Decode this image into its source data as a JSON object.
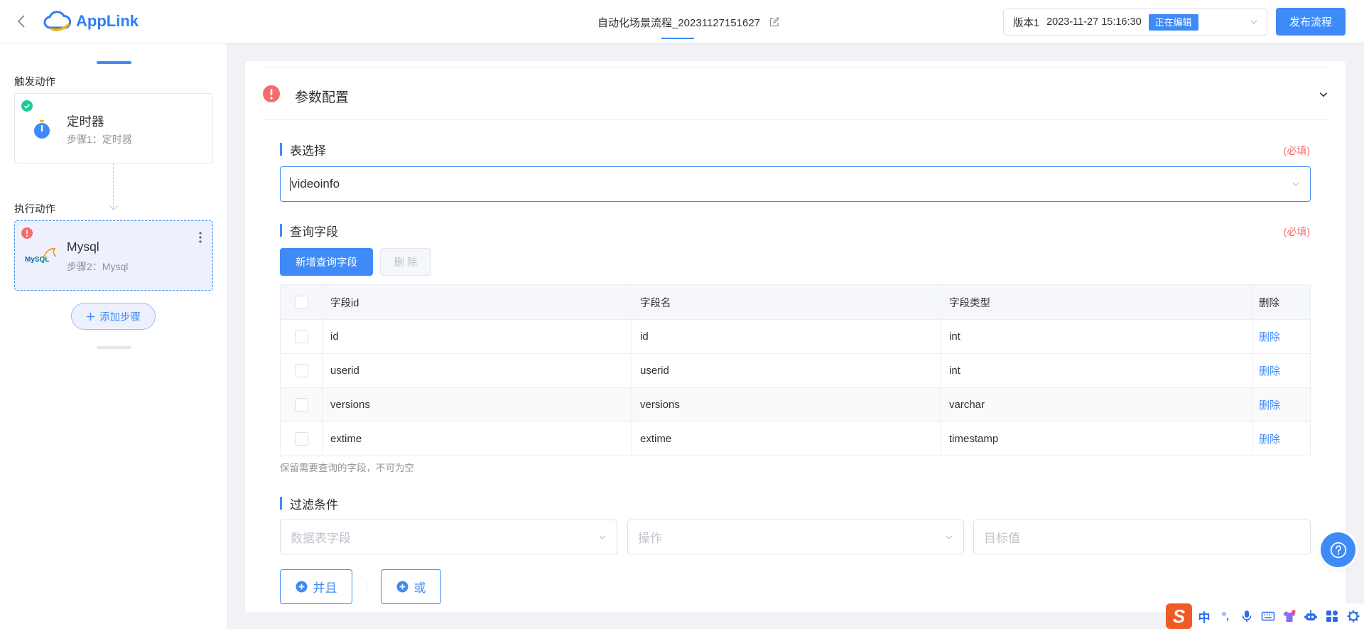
{
  "colors": {
    "primary": "#3e8bf8",
    "danger": "#f56c6c",
    "success": "#20c997",
    "page_bg": "#f0f2f5",
    "selected_bg": "#eef1fd",
    "ime_accent": "#2b6de5",
    "sogou_orange": "#f05a24"
  },
  "icons": [
    "chevron-left-icon",
    "cloud-logo-icon",
    "edit-icon",
    "chevron-down-icon",
    "check-circle-icon",
    "timer-icon",
    "error-icon",
    "mysql-logo-icon",
    "more-vertical-icon",
    "plus-icon",
    "plus-circle-icon",
    "help-icon",
    "microphone-icon",
    "keyboard-icon",
    "skin-icon",
    "robot-icon",
    "toolbox-icon",
    "settings-icon"
  ],
  "header": {
    "logo_text": "AppLink",
    "title": "自动化场景流程_20231127151627",
    "version": {
      "label": "版本1",
      "datetime": "2023-11-27 15:16:30",
      "status": "正在编辑"
    },
    "publish_label": "发布流程"
  },
  "sidebar": {
    "trigger_heading": "触发动作",
    "trigger_step": {
      "name": "定时器",
      "subtitle": "步骤1：定时器",
      "status_icon": "check-circle-icon"
    },
    "action_heading": "执行动作",
    "action_step": {
      "name": "Mysql",
      "subtitle": "步骤2：Mysql",
      "logo_text": "MySQL",
      "status_icon": "error-icon"
    },
    "add_step_label": "添加步骤"
  },
  "section": {
    "title": "参数配置",
    "status_icon": "error-icon",
    "table_select": {
      "heading": "表选择",
      "required": "(必填)",
      "value": "videoinfo"
    },
    "query_fields": {
      "heading": "查询字段",
      "required": "(必填)",
      "add_label": "新增查询字段",
      "delete_label": "删 除",
      "columns": [
        "字段id",
        "字段名",
        "字段类型",
        "删除"
      ],
      "rows": [
        {
          "id": "id",
          "name": "id",
          "type": "int",
          "action": "删除",
          "checked": false
        },
        {
          "id": "userid",
          "name": "userid",
          "type": "int",
          "action": "删除",
          "checked": false
        },
        {
          "id": "versions",
          "name": "versions",
          "type": "varchar",
          "action": "删除",
          "checked": false
        },
        {
          "id": "extime",
          "name": "extime",
          "type": "timestamp",
          "action": "删除",
          "checked": false
        }
      ],
      "hint": "保留需要查询的字段，不可为空"
    },
    "filter": {
      "heading": "过滤条件",
      "field_placeholder": "数据表字段",
      "operator_placeholder": "操作",
      "value_placeholder": "目标值",
      "and_label": "并且",
      "or_label": "或"
    }
  },
  "ime": {
    "logo_text": "S",
    "mode": "中",
    "punct": "°,"
  }
}
